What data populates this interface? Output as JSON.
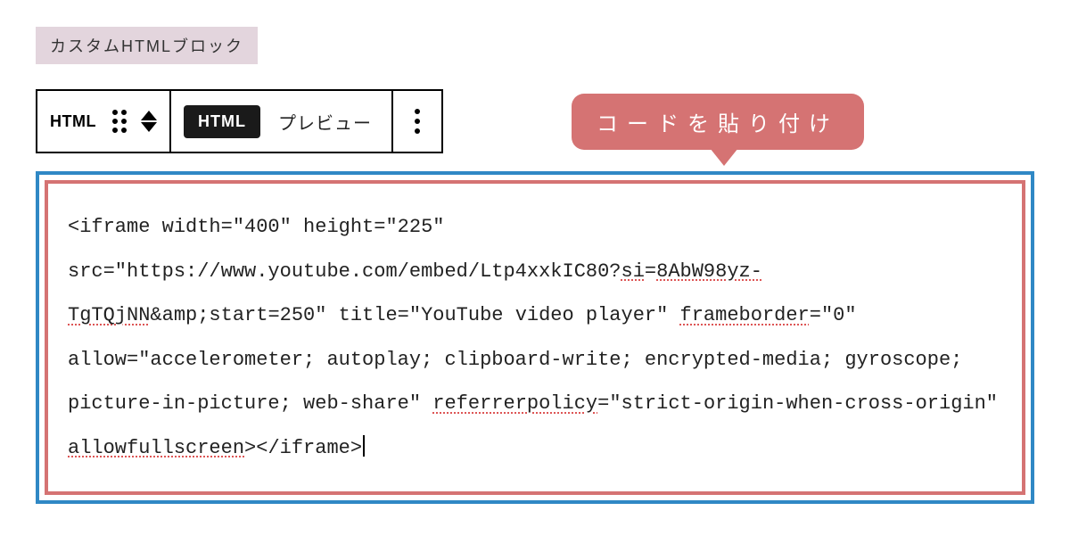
{
  "block": {
    "label": "カスタムHTMLブロック"
  },
  "toolbar": {
    "html_label": "HTML",
    "html_button": "HTML",
    "preview_button": "プレビュー"
  },
  "callout": {
    "text": "コードを貼り付け"
  },
  "code": {
    "segments": [
      {
        "t": "<iframe width=\"400\" height=\"225\" src=\"https://www.youtube.com/embed/Ltp4xxkIC80?",
        "s": false
      },
      {
        "t": "si",
        "s": true
      },
      {
        "t": "=",
        "s": false
      },
      {
        "t": "8AbW98yz-TgTQjNN",
        "s": true
      },
      {
        "t": "&amp;start=250\" title=\"YouTube video player\" ",
        "s": false
      },
      {
        "t": "frameborder",
        "s": true
      },
      {
        "t": "=\"0\" allow=\"accelerometer; autoplay; clipboard-write; encrypted-media; gyroscope; picture-in-picture; web-share\" ",
        "s": false
      },
      {
        "t": "referrerpolicy",
        "s": true
      },
      {
        "t": "=\"strict-origin-when-cross-origin\" ",
        "s": false
      },
      {
        "t": "allowfullscreen",
        "s": true
      },
      {
        "t": "></iframe>",
        "s": false
      }
    ]
  }
}
